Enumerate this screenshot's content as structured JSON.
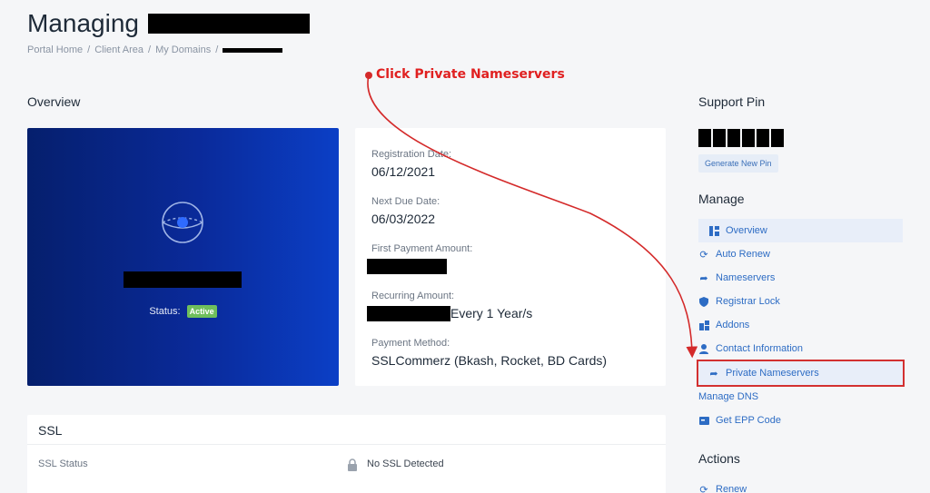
{
  "page": {
    "title": "Managing",
    "breadcrumb": [
      "Portal Home",
      "Client Area",
      "My Domains"
    ],
    "separator": "/"
  },
  "overview": {
    "heading": "Overview",
    "status_label": "Status:",
    "status_value": "Active",
    "colors": {
      "hero_start": "#051f6d",
      "hero_end": "#0b3fc6",
      "badge": "#6fbf5c"
    }
  },
  "details": {
    "registration_date_label": "Registration Date:",
    "registration_date": "06/12/2021",
    "next_due_date_label": "Next Due Date:",
    "next_due_date": "06/03/2022",
    "first_payment_label": "First Payment Amount:",
    "recurring_label": "Recurring Amount:",
    "recurring_suffix": "Every 1 Year/s",
    "payment_method_label": "Payment Method:",
    "payment_method": "SSLCommerz (Bkash, Rocket, BD Cards)"
  },
  "ssl": {
    "heading": "SSL",
    "status_label": "SSL Status",
    "status_value": "No SSL Detected",
    "icon": "lock-icon"
  },
  "sidebar": {
    "support_pin_heading": "Support Pin",
    "generate_pin_label": "Generate New Pin",
    "manage_heading": "Manage",
    "items": [
      {
        "label": "Overview",
        "icon": "dashboard-icon"
      },
      {
        "label": "Auto Renew",
        "icon": "refresh-icon"
      },
      {
        "label": "Nameservers",
        "icon": "share-arrow-icon"
      },
      {
        "label": "Registrar Lock",
        "icon": "shield-icon"
      },
      {
        "label": "Addons",
        "icon": "cubes-icon"
      },
      {
        "label": "Contact Information",
        "icon": "user-icon"
      },
      {
        "label": "Private Nameservers",
        "icon": "share-arrow-icon"
      },
      {
        "label": "Manage DNS",
        "icon": ""
      },
      {
        "label": "Get EPP Code",
        "icon": "card-icon"
      }
    ],
    "actions_heading": "Actions",
    "actions": [
      {
        "label": "Renew",
        "icon": "cart-icon"
      }
    ]
  },
  "annotation": {
    "text": "Click Private Nameservers",
    "color": "#e02020"
  }
}
